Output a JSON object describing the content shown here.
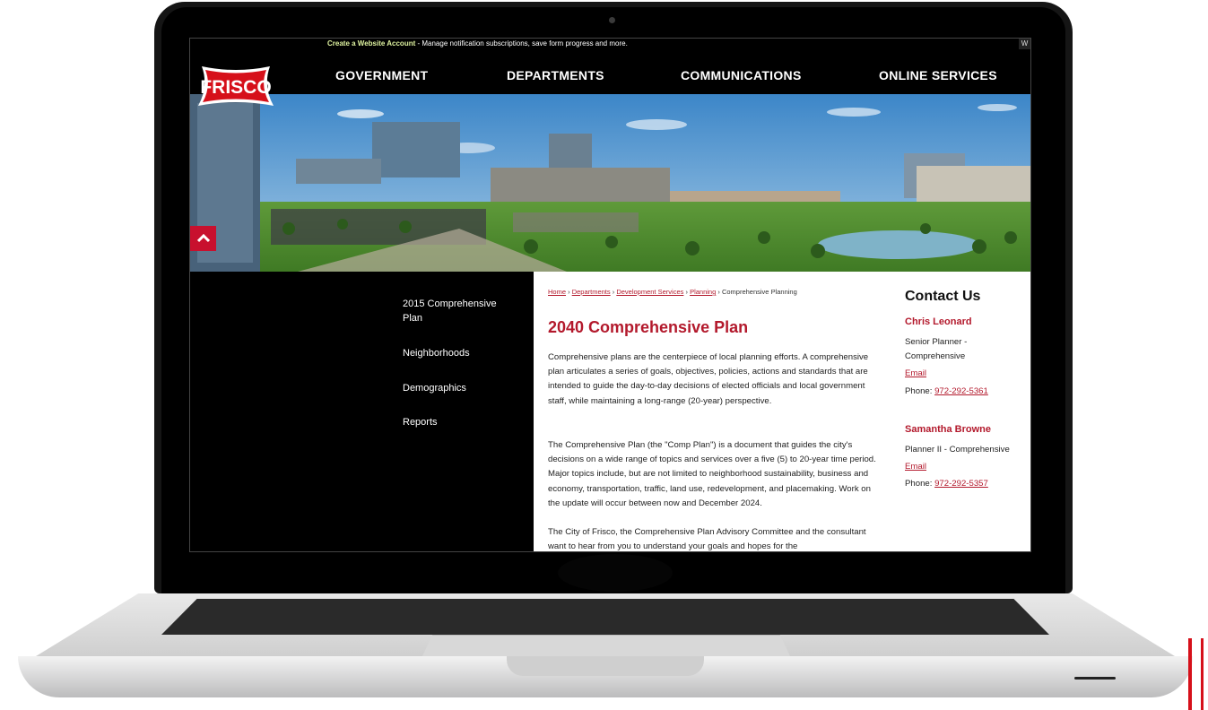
{
  "topbar": {
    "link": "Create a Website Account",
    "message": " - Manage notification subscriptions, save form progress and more.",
    "edge_char": "W"
  },
  "logo": {
    "text": "FRISCO"
  },
  "nav": {
    "items": [
      "GOVERNMENT",
      "DEPARTMENTS",
      "COMMUNICATIONS",
      "ONLINE SERVICES"
    ]
  },
  "sidebar": {
    "items": [
      "2015 Comprehensive Plan",
      "Neighborhoods",
      "Demographics",
      "Reports"
    ]
  },
  "breadcrumb": {
    "links": [
      "Home",
      "Departments",
      "Development Services",
      "Planning"
    ],
    "separator": "›",
    "current": "Comprehensive Planning"
  },
  "main": {
    "title": "2040 Comprehensive Plan",
    "paragraphs": [
      "Comprehensive plans are the centerpiece of local planning efforts. A comprehensive plan articulates a series of goals, objectives, policies, actions and standards that are intended to guide the day-to-day decisions of elected officials and local government staff, while maintaining a long-range (20-year) perspective.",
      "The Comprehensive Plan (the \"Comp Plan\") is a document that guides the city's decisions on a wide range of topics and services over a five (5) to 20-year time period. Major topics include, but are not limited to neighborhood sustainability, business and economy, transportation, traffic, land use, redevelopment, and placemaking. Work on the update will occur between now and December 2024.",
      "The City of Frisco, the Comprehensive Plan Advisory Committee and the consultant want to hear from you to understand your goals and hopes for the"
    ]
  },
  "contact": {
    "title": "Contact Us",
    "people": [
      {
        "name": "Chris Leonard",
        "role": "Senior Planner - Comprehensive",
        "email_label": "Email",
        "phone_label": "Phone: ",
        "phone": "972-292-5361"
      },
      {
        "name": "Samantha Browne",
        "role": "Planner II - Comprehensive",
        "email_label": "Email",
        "phone_label": "Phone: ",
        "phone": "972-292-5357"
      }
    ]
  },
  "colors": {
    "brand_red": "#b3192c",
    "accent_red": "#c8102e",
    "nav_bg": "#000000"
  },
  "icons": {
    "scroll_up": "chevron-up-icon"
  }
}
